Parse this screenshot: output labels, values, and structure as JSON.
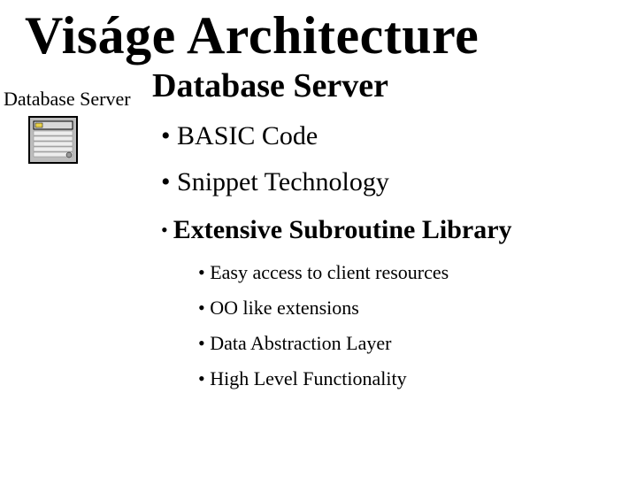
{
  "title": "Viságe Architecture",
  "sideLabel": "Database Server",
  "heading": "Database Server",
  "bullets": {
    "b1": "BASIC Code",
    "b2": "Snippet Technology",
    "b3": "Extensive Subroutine Library",
    "sub1": "Easy access to client resources",
    "sub2": "OO like extensions",
    "sub3": "Data Abstraction Layer",
    "sub4": "High Level Functionality"
  }
}
